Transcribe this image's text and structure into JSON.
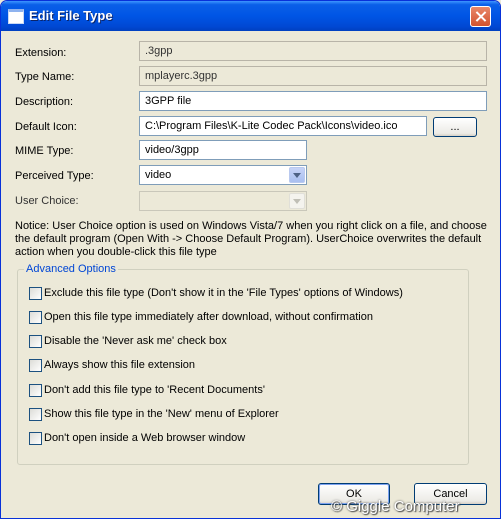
{
  "window": {
    "title": "Edit File Type",
    "icon": "window-icon",
    "close_icon": "close-icon"
  },
  "fields": {
    "extension": {
      "label": "Extension:",
      "value": ".3gpp"
    },
    "type_name": {
      "label": "Type Name:",
      "value": "mplayerc.3gpp"
    },
    "description": {
      "label": "Description:",
      "value": "3GPP file"
    },
    "default_icon": {
      "label": "Default Icon:",
      "value": "C:\\Program Files\\K-Lite Codec Pack\\Icons\\video.ico",
      "browse_label": "..."
    },
    "mime_type": {
      "label": "MIME Type:",
      "value": "video/3gpp"
    },
    "perceived_type": {
      "label": "Perceived Type:",
      "value": "video"
    },
    "user_choice": {
      "label": "User Choice:",
      "value": ""
    }
  },
  "notice": "Notice: User Choice option is used on Windows Vista/7 when you right click on a file, and choose the default program (Open With -> Choose Default Program). UserChoice overwrites the default action when you double-click this file type",
  "advanced": {
    "title": "Advanced Options",
    "options": [
      {
        "label": "Exclude  this file type (Don't show it in the 'File Types' options of Windows)",
        "checked": false
      },
      {
        "label": "Open this file type immediately after download, without confirmation",
        "checked": false
      },
      {
        "label": "Disable the 'Never ask me' check box",
        "checked": false
      },
      {
        "label": "Always show this file extension",
        "checked": false
      },
      {
        "label": "Don't add this file type to 'Recent Documents'",
        "checked": false
      },
      {
        "label": "Show this file type in the 'New' menu of Explorer",
        "checked": false
      },
      {
        "label": "Don't open inside a Web browser window",
        "checked": false
      }
    ]
  },
  "buttons": {
    "ok": "OK",
    "cancel": "Cancel"
  },
  "watermark": "© Giggle Computer",
  "colors": {
    "titlebar": "#0055e5",
    "dialog_bg": "#ece9d8",
    "group_title": "#0046d5",
    "input_border": "#7f9db9"
  }
}
